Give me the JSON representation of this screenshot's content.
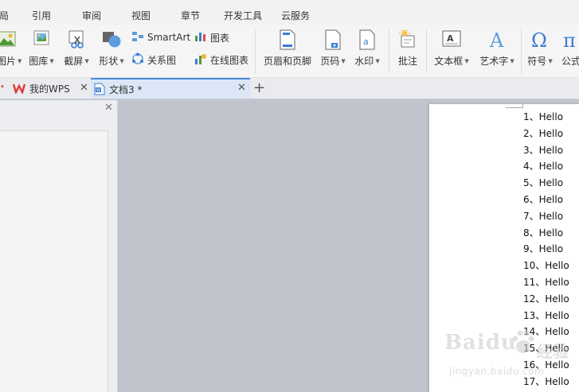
{
  "menu": {
    "items": [
      "局",
      "引用",
      "审阅",
      "视图",
      "章节",
      "开发工具",
      "云服务"
    ]
  },
  "ribbon": {
    "picture_label": "图片",
    "gallery_label": "图库",
    "screenshot_label": "截屏",
    "shapes_label": "形状",
    "smartart_label": "SmartArt",
    "chart_label": "图表",
    "relation_label": "关系图",
    "online_chart_label": "在线图表",
    "header_footer_label": "页眉和页脚",
    "page_number_label": "页码",
    "watermark_label": "水印",
    "comment_label": "批注",
    "textbox_label": "文本框",
    "wordart_label": "艺术字",
    "symbol_label": "符号",
    "formula_label": "公式"
  },
  "tabs": {
    "home_label": "我的WPS",
    "doc_label": "文档3 *"
  },
  "document": {
    "lines": [
      "1、Hello",
      "2、Hello",
      "3、Hello",
      "4、Hello",
      "5、Hello",
      "6、Hello",
      "7、Hello",
      "8、Hello",
      "9、Hello",
      "10、Hello",
      "11、Hello",
      "12、Hello",
      "13、Hello",
      "14、Hello",
      "15、Hello",
      "16、Hello",
      "17、Hello"
    ]
  },
  "watermark": {
    "brand": "Baidu",
    "cn": "经验",
    "url": "jingyan.baidu.com"
  },
  "colors": {
    "accent": "#4a8ad8",
    "wps_red": "#e03a2f",
    "workspace": "#c1c4cc"
  }
}
